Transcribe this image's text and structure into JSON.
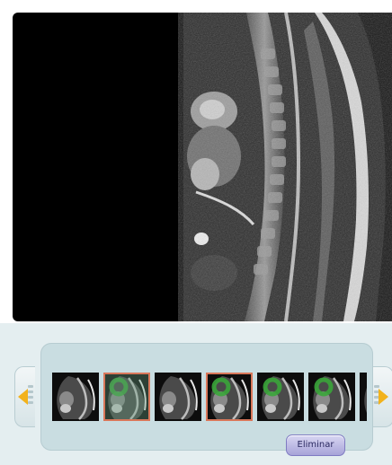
{
  "viewer": {
    "image_icon": "mri-sagittal-image"
  },
  "thumbnail_strip": {
    "thumbnails": [
      {
        "selected": false,
        "green_marker": false
      },
      {
        "selected": true,
        "green_marker": true
      },
      {
        "selected": false,
        "green_marker": false
      },
      {
        "selected": true,
        "green_marker": true
      },
      {
        "selected": false,
        "green_marker": true
      },
      {
        "selected": false,
        "green_marker": true
      },
      {
        "selected": false,
        "green_marker": false
      }
    ],
    "prev_icon": "arrow-left-icon",
    "next_icon": "arrow-right-icon"
  },
  "actions": {
    "delete_label": "Eliminar"
  },
  "colors": {
    "background": "#e4eef0",
    "strip_panel": "#c9dde1",
    "arrow": "#f2b21c",
    "selection_border": "#d9775a",
    "marker": "#3aa53a",
    "button": "#a7a3d8"
  }
}
